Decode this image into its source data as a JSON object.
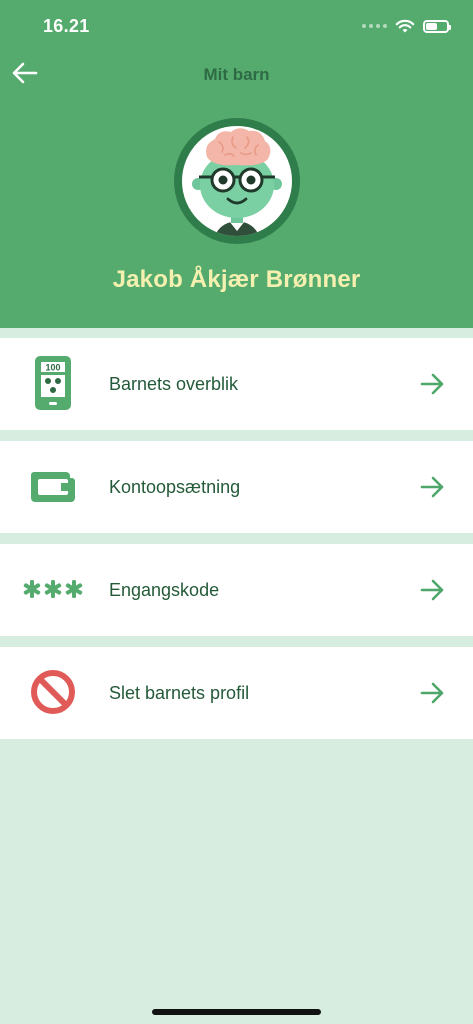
{
  "status_bar": {
    "time": "16.21"
  },
  "header": {
    "title": "Mit barn",
    "child_name": "Jakob Åkjær Brønner"
  },
  "menu": {
    "items": [
      {
        "label": "Barnets overblik",
        "icon": "phone-overview-icon",
        "badge": "100"
      },
      {
        "label": "Kontoopsætning",
        "icon": "wallet-icon"
      },
      {
        "label": "Engangskode",
        "icon": "asterisks-icon",
        "glyph": "***"
      },
      {
        "label": "Slet barnets profil",
        "icon": "prohibited-icon"
      }
    ]
  },
  "colors": {
    "header_green": "#55ab6e",
    "title_dark_green": "#2e6b45",
    "name_yellow": "#f5f0b0",
    "background_mint": "#d6ede0",
    "arrow_green": "#4ea66a",
    "danger_red": "#e05a57"
  }
}
